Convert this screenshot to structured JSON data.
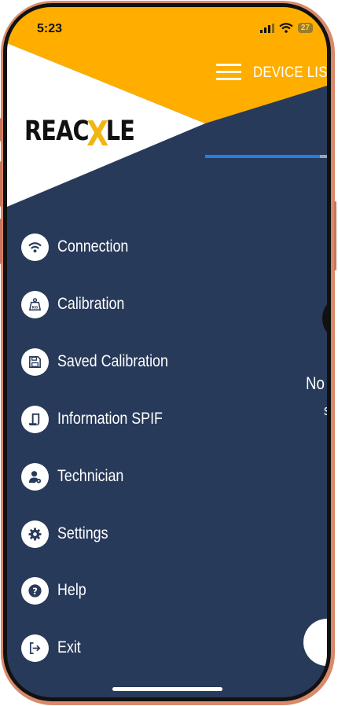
{
  "status_bar": {
    "time": "5:23",
    "battery": "27"
  },
  "header": {
    "title": "DEVICE LIST"
  },
  "logo": {
    "left": "REAC",
    "x": "X",
    "right": "LE"
  },
  "progress": {
    "fraction": 0.94
  },
  "drawer": {
    "items": [
      {
        "label": "Connection",
        "icon": "wifi-icon"
      },
      {
        "label": "Calibration",
        "icon": "weight-kg-icon"
      },
      {
        "label": "Saved Calibration",
        "icon": "floppy-disk-icon"
      },
      {
        "label": "Information SPIF",
        "icon": "document-icon"
      },
      {
        "label": "Technician",
        "icon": "technician-icon"
      },
      {
        "label": "Settings",
        "icon": "gear-icon"
      },
      {
        "label": "Help",
        "icon": "question-icon"
      },
      {
        "label": "Exit",
        "icon": "exit-icon"
      }
    ]
  },
  "background": {
    "partial_text_1": "No",
    "partial_text_2": "s"
  },
  "colors": {
    "accent": "#FFAE00",
    "navy": "#283A5A",
    "progress": "#1F7FE6"
  }
}
